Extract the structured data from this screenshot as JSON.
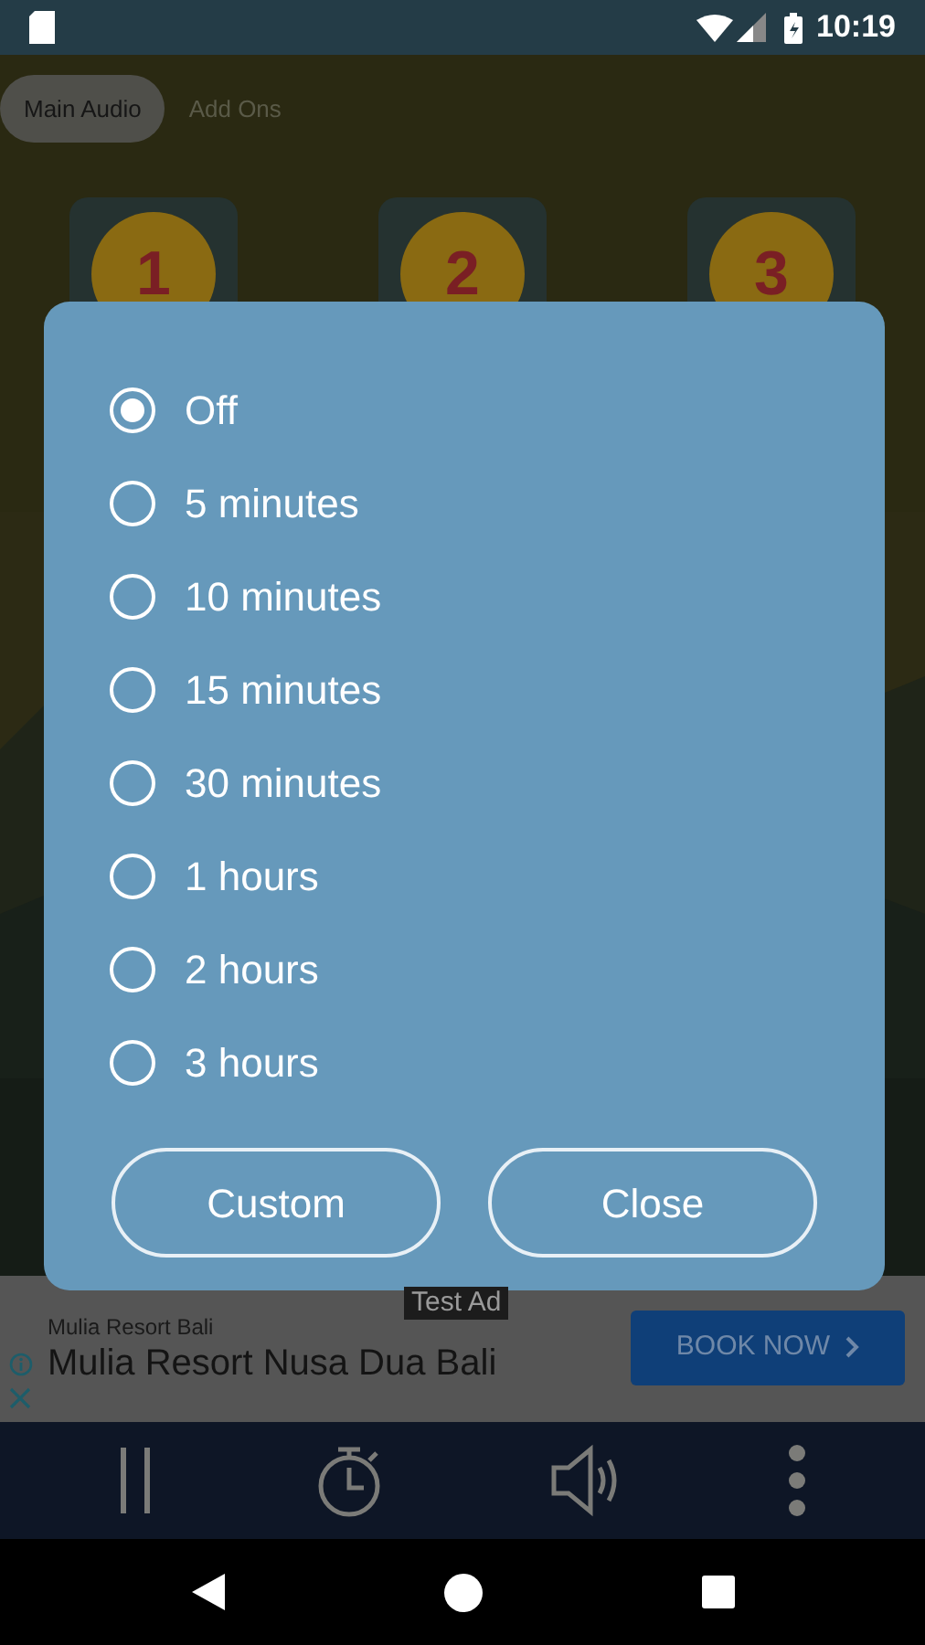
{
  "status_bar": {
    "time": "10:19"
  },
  "tabs": [
    {
      "label": "Main Audio",
      "selected": true
    },
    {
      "label": "Add Ons",
      "selected": false
    }
  ],
  "tiles": [
    {
      "label": "1"
    },
    {
      "label": "2"
    },
    {
      "label": "3"
    }
  ],
  "dialog": {
    "options": [
      {
        "label": "Off",
        "selected": true
      },
      {
        "label": "5 minutes",
        "selected": false
      },
      {
        "label": "10 minutes",
        "selected": false
      },
      {
        "label": "15 minutes",
        "selected": false
      },
      {
        "label": "30 minutes",
        "selected": false
      },
      {
        "label": "1 hours",
        "selected": false
      },
      {
        "label": "2 hours",
        "selected": false
      },
      {
        "label": "3 hours",
        "selected": false
      }
    ],
    "buttons": [
      "Custom",
      "Close"
    ]
  },
  "ad": {
    "badge": "Test Ad",
    "advertiser": "Mulia Resort Bali",
    "headline": "Mulia Resort Nusa Dua Bali",
    "button": "BOOK NOW"
  }
}
